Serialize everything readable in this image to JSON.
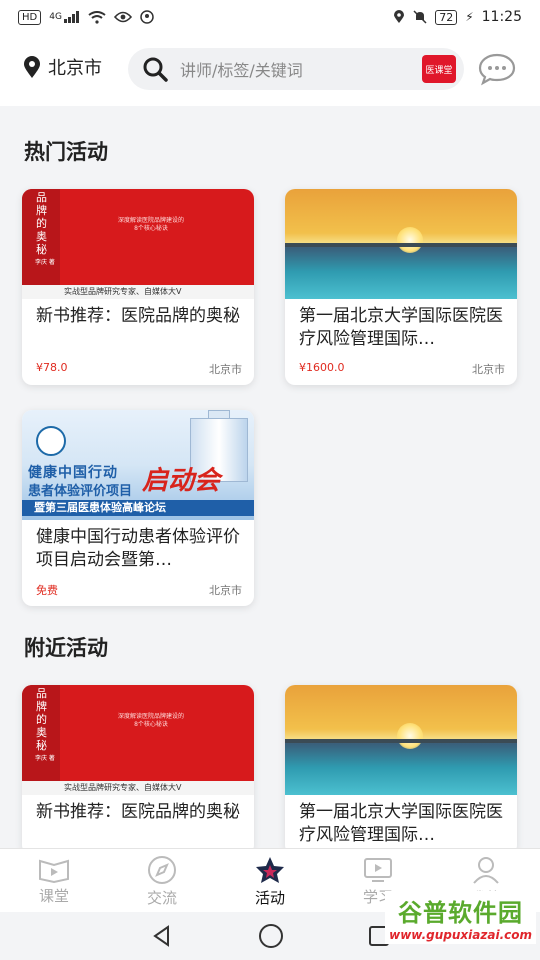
{
  "status_bar": {
    "left_chips": [
      "HD",
      "4G"
    ],
    "battery": "72",
    "time": "11:25"
  },
  "header": {
    "location": "北京市",
    "search_placeholder": "讲师/标签/关键词",
    "brand_badge": "医课堂"
  },
  "sections": {
    "hot_title": "热门活动",
    "nearby_title": "附近活动"
  },
  "hot_activities": [
    {
      "title": "新书推荐：医院品牌的奥秘",
      "price": "¥78.0",
      "city": "北京市",
      "thumb": "book"
    },
    {
      "title": "第一届北京大学国际医院医疗风险管理国际…",
      "price": "¥1600.0",
      "city": "北京市",
      "thumb": "sunset"
    },
    {
      "title": "健康中国行动患者体验评价项目启动会暨第…",
      "price": "免费",
      "city": "北京市",
      "thumb": "health"
    }
  ],
  "nearby_activities": [
    {
      "title": "新书推荐：医院品牌的奥秘",
      "thumb": "book"
    },
    {
      "title": "第一届北京大学国际医院医疗风险管理国际…",
      "thumb": "sunset"
    }
  ],
  "book_cover": {
    "spine_text": "品牌的奥秘",
    "author": "李庆 著",
    "tiny_text": "深度解读医院品牌建设的\n8个核心秘诀",
    "strip_text": "实战型品牌研究专家、自媒体大V"
  },
  "health_banner": {
    "line1": "健康中国行动",
    "line2": "患者体验评价项目",
    "big": "启动会",
    "bar": "暨第三届医患体验高峰论坛"
  },
  "tabs": [
    {
      "label": "课堂",
      "icon": "play-book-icon",
      "active": false
    },
    {
      "label": "交流",
      "icon": "compass-icon",
      "active": false
    },
    {
      "label": "活动",
      "icon": "star-icon",
      "active": true
    },
    {
      "label": "学习",
      "icon": "video-icon",
      "active": false
    },
    {
      "label": "我的",
      "icon": "user-icon",
      "active": false
    }
  ],
  "watermark": {
    "title": "谷普软件园",
    "url": "www.gupuxiazai.com"
  },
  "colors": {
    "accent_red": "#e02b20",
    "active_tab_star": "#c8285a"
  }
}
